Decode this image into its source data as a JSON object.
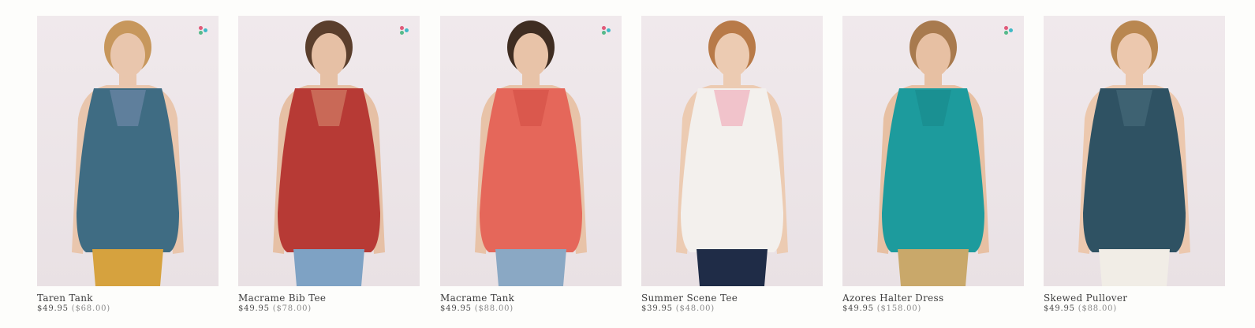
{
  "products": [
    {
      "name": "Taren Tank",
      "price": "$49.95",
      "original_price": "($68.00)",
      "swatch_icon": true,
      "palette": {
        "skin": "#e9c6ad",
        "hair": "#c7975c",
        "top": "#3f6c83",
        "top_accent": "#7a8fb0",
        "bottom": "#d6a23e"
      }
    },
    {
      "name": "Macrame Bib Tee",
      "price": "$49.95",
      "original_price": "($78.00)",
      "swatch_icon": true,
      "palette": {
        "skin": "#e6c0a5",
        "hair": "#5a3e2c",
        "top": "#b73a35",
        "top_accent": "#d98f72",
        "bottom": "#7ea2c4"
      }
    },
    {
      "name": "Macrame Tank",
      "price": "$49.95",
      "original_price": "($88.00)",
      "swatch_icon": true,
      "palette": {
        "skin": "#e8c3a8",
        "hair": "#3f2d22",
        "top": "#e5675a",
        "top_accent": "#d14c44",
        "bottom": "#8aa8c4"
      }
    },
    {
      "name": "Summer Scene Tee",
      "price": "$39.95",
      "original_price": "($48.00)",
      "swatch_icon": false,
      "palette": {
        "skin": "#eccbb2",
        "hair": "#b87a48",
        "top": "#f3f0ed",
        "top_accent": "#ef9fae",
        "bottom": "#1f2c47"
      }
    },
    {
      "name": "Azores Halter Dress",
      "price": "$49.95",
      "original_price": "($158.00)",
      "swatch_icon": true,
      "palette": {
        "skin": "#e7c0a3",
        "hair": "#a87a4e",
        "top": "#1d9b9d",
        "top_accent": "#178688",
        "bottom": "#c9a86a"
      }
    },
    {
      "name": "Skewed Pullover",
      "price": "$49.95",
      "original_price": "($88.00)",
      "swatch_icon": false,
      "palette": {
        "skin": "#ecc8ae",
        "hair": "#b98750",
        "top": "#2f5263",
        "top_accent": "#4b6f7f",
        "bottom": "#f1ede6"
      }
    }
  ],
  "swatch_colors": [
    "#e05a7a",
    "#3fb9c6",
    "#56b98a"
  ]
}
